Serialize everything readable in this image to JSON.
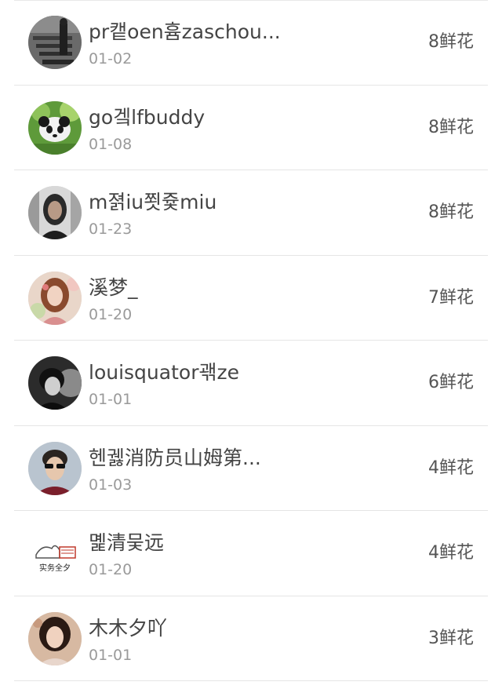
{
  "leaderboard": {
    "rows": [
      {
        "name": "pr캩oen흄zaschou...",
        "date": "01-02",
        "count": "8鲜花",
        "avatar": "stairs-photo-avatar"
      },
      {
        "name": "go겤lfbuddy",
        "date": "01-08",
        "count": "8鲜花",
        "avatar": "panda-photo-avatar"
      },
      {
        "name": "m졁iu쬣즃miu",
        "date": "01-23",
        "count": "8鲜花",
        "avatar": "portrait-photo-avatar"
      },
      {
        "name": "溪梦_",
        "date": "01-20",
        "count": "7鲜花",
        "avatar": "illustrated-girl-avatar"
      },
      {
        "name": "louisquator괚ze",
        "date": "01-01",
        "count": "6鲜花",
        "avatar": "bw-portrait-avatar"
      },
      {
        "name": "헨궳消防员山姆第...",
        "date": "01-03",
        "count": "4鲜花",
        "avatar": "sunglasses-man-avatar"
      },
      {
        "name": "몙清뭊远",
        "date": "01-20",
        "count": "4鲜花",
        "avatar": "sketch-avatar",
        "avatar_text": "实务全夕"
      },
      {
        "name": "木木夕吖",
        "date": "01-01",
        "count": "3鲜花",
        "avatar": "woman-photo-avatar"
      }
    ]
  },
  "colors": {
    "name_text": "#444444",
    "date_text": "#9a9a9a",
    "count_text": "#555555",
    "divider": "#e5e5e5"
  }
}
